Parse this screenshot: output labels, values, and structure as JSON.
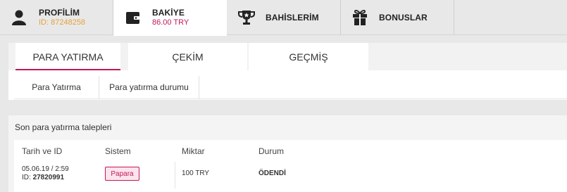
{
  "top_tabs": [
    {
      "id": "profile",
      "icon": "person-icon",
      "label": "PROFİLİM",
      "sub": "ID: 87248258",
      "sub_color": "#e5a23b"
    },
    {
      "id": "balance",
      "icon": "wallet-icon",
      "label": "BAKİYE",
      "sub": "86.00 TRY",
      "sub_color": "#c2185b",
      "active": true
    },
    {
      "id": "bets",
      "icon": "trophy-icon",
      "label": "BAHİSLERİM"
    },
    {
      "id": "bonuses",
      "icon": "gift-icon",
      "label": "BONUSLAR"
    }
  ],
  "sub_tabs": [
    {
      "label": "PARA YATIRMA",
      "active": true
    },
    {
      "label": "ÇEKİM"
    },
    {
      "label": "GEÇMİŞ"
    }
  ],
  "inner_tabs": [
    {
      "label": "Para Yatırma"
    },
    {
      "label": "Para yatırma durumu"
    }
  ],
  "recent": {
    "title": "Son para yatırma talepleri",
    "headers": [
      "Tarih ve ID",
      "Sistem",
      "Miktar",
      "Durum"
    ],
    "row": {
      "date": "05.06.19 / 2:59",
      "id_prefix": "ID:",
      "id_value": "27820991",
      "system": "Papara",
      "amount": "100 TRY",
      "status": "ÖDENDİ"
    }
  },
  "colors": {
    "accent": "#c2185b",
    "id_color": "#e5a23b"
  }
}
